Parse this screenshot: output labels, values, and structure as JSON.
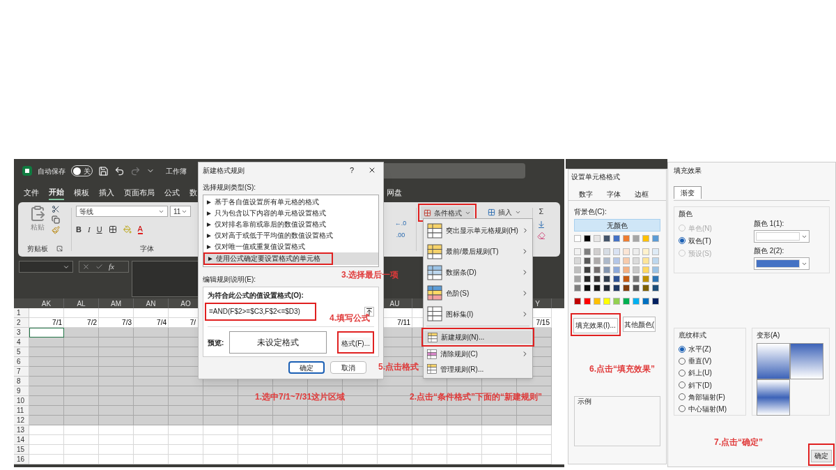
{
  "excel": {
    "autosave_label": "自动保存",
    "autosave_toggle": {
      "label": "关",
      "on": false
    },
    "doc_title": "工作簿",
    "tabs": [
      {
        "label": "文件",
        "selected": false
      },
      {
        "label": "开始",
        "selected": true
      },
      {
        "label": "模板",
        "selected": false
      },
      {
        "label": "插入",
        "selected": false
      },
      {
        "label": "页面布局",
        "selected": false
      },
      {
        "label": "公式",
        "selected": false
      },
      {
        "label": "数",
        "selected": false
      }
    ],
    "tab_cut": "网盘",
    "ribbon": {
      "paste": "粘贴",
      "clipboard_group": "剪贴板",
      "font_name": "等线",
      "font_size": "11",
      "bold": "B",
      "italic": "I",
      "underline": "U",
      "font_color": "A",
      "font_group": "字体",
      "add_decimal": "←.0",
      "remove_decimal": ".00",
      "conditional_format": "条件格式",
      "insert": "插入",
      "sum": "Σ"
    },
    "formula_fx": "fx",
    "columns": [
      {
        "header": "AK",
        "date": "7/1"
      },
      {
        "header": "AL",
        "date": "7/2"
      },
      {
        "header": "AM",
        "date": "7/3"
      },
      {
        "header": "AN",
        "date": "7/4"
      },
      {
        "header": "AO",
        "date": "7/"
      },
      {
        "header": "AU",
        "date": "7/11"
      },
      {
        "header": "Y",
        "date": "7/15"
      }
    ],
    "rows": [
      {
        "number": "1",
        "selected": false,
        "active_first_cell": false
      },
      {
        "number": "2",
        "selected": false,
        "active_first_cell": false
      },
      {
        "number": "3",
        "selected": true,
        "active_first_cell": true
      },
      {
        "number": "4",
        "selected": true,
        "active_first_cell": false
      },
      {
        "number": "5",
        "selected": true,
        "active_first_cell": false
      },
      {
        "number": "6",
        "selected": true,
        "active_first_cell": false
      },
      {
        "number": "7",
        "selected": true,
        "active_first_cell": false
      },
      {
        "number": "8",
        "selected": true,
        "active_first_cell": false
      },
      {
        "number": "9",
        "selected": true,
        "active_first_cell": false
      },
      {
        "number": "10",
        "selected": true,
        "active_first_cell": false
      },
      {
        "number": "11",
        "selected": true,
        "active_first_cell": false
      },
      {
        "number": "12",
        "selected": true,
        "active_first_cell": false
      },
      {
        "number": "13",
        "selected": false,
        "active_first_cell": false
      },
      {
        "number": "14",
        "selected": false,
        "active_first_cell": false
      },
      {
        "number": "15",
        "selected": false,
        "active_first_cell": false
      },
      {
        "number": "16",
        "selected": false,
        "active_first_cell": false
      }
    ]
  },
  "rule_dialog": {
    "title": "新建格式规则",
    "help": "?",
    "type_label": "选择规则类型(S):",
    "rule_types": [
      {
        "label": "► 基于各自值设置所有单元格的格式",
        "selected": false
      },
      {
        "label": "► 只为包含以下内容的单元格设置格式",
        "selected": false
      },
      {
        "label": "► 仅对排名靠前或靠后的数值设置格式",
        "selected": false
      },
      {
        "label": "► 仅对高于或低于平均值的数值设置格式",
        "selected": false
      },
      {
        "label": "► 仅对唯一值或重复值设置格式",
        "selected": false
      },
      {
        "label": "► 使用公式确定要设置格式的单元格",
        "selected": true
      }
    ],
    "edit_label": "编辑规则说明(E):",
    "formula_label": "为符合此公式的值设置格式(O):",
    "formula": "=AND(F$2>=$C3,F$2<=$D3)",
    "preview_label": "预览:",
    "preview_text": "未设定格式",
    "format_button": "格式(F)...",
    "ok": "确定",
    "cancel": "取消"
  },
  "cf_menu": {
    "items": [
      {
        "label": "突出显示单元格规则(H)",
        "kind": "highlight",
        "submenu": true
      },
      {
        "label": "最前/最后规则(T)",
        "kind": "topbottom",
        "submenu": true
      },
      {
        "label": "数据条(D)",
        "kind": "databar",
        "submenu": true
      },
      {
        "label": "色阶(S)",
        "kind": "colorscale",
        "submenu": true
      },
      {
        "label": "图标集(I)",
        "kind": "iconset",
        "submenu": true
      },
      {
        "label": "新建规则(N)...",
        "kind": "newrule",
        "submenu": false
      },
      {
        "label": "清除规则(C)",
        "kind": "clear",
        "submenu": true
      },
      {
        "label": "管理规则(R)...",
        "kind": "manage",
        "submenu": false
      }
    ]
  },
  "format_dialog": {
    "title": "设置单元格格式",
    "tabs": [
      {
        "label": "数字",
        "selected": false
      },
      {
        "label": "字体",
        "selected": false
      },
      {
        "label": "边框",
        "selected": false
      }
    ],
    "bg_label": "背景色(C):",
    "no_color": "无颜色",
    "swatch_rows": [
      {
        "swatches": [
          {
            "color": "#ffffff"
          },
          {
            "color": "#000000"
          },
          {
            "color": "#e7e6e6"
          },
          {
            "color": "#44546a"
          },
          {
            "color": "#4472c4"
          },
          {
            "color": "#ed7d31"
          },
          {
            "color": "#a5a5a5"
          },
          {
            "color": "#ffc000"
          },
          {
            "color": "#5b9bd5"
          }
        ]
      },
      {
        "swatches": [
          {
            "color": "#f2f2f2"
          },
          {
            "color": "#7f7f7f"
          },
          {
            "color": "#d0cece"
          },
          {
            "color": "#d6dce4"
          },
          {
            "color": "#d9e2f3"
          },
          {
            "color": "#fbe5d5"
          },
          {
            "color": "#ededed"
          },
          {
            "color": "#fff2cc"
          },
          {
            "color": "#deebf6"
          }
        ]
      },
      {
        "swatches": [
          {
            "color": "#d8d8d8"
          },
          {
            "color": "#595959"
          },
          {
            "color": "#aeabab"
          },
          {
            "color": "#adb9ca"
          },
          {
            "color": "#b4c6e7"
          },
          {
            "color": "#f7cbac"
          },
          {
            "color": "#dbdbdb"
          },
          {
            "color": "#fee599"
          },
          {
            "color": "#bdd7ee"
          }
        ]
      },
      {
        "swatches": [
          {
            "color": "#bfbfbf"
          },
          {
            "color": "#3f3f3f"
          },
          {
            "color": "#757070"
          },
          {
            "color": "#8496b0"
          },
          {
            "color": "#8eaadb"
          },
          {
            "color": "#f4b183"
          },
          {
            "color": "#c9c9c9"
          },
          {
            "color": "#ffd965"
          },
          {
            "color": "#9cc3e5"
          }
        ]
      },
      {
        "swatches": [
          {
            "color": "#a5a5a5"
          },
          {
            "color": "#262626"
          },
          {
            "color": "#3a3838"
          },
          {
            "color": "#323f4f"
          },
          {
            "color": "#2f5496"
          },
          {
            "color": "#c55a11"
          },
          {
            "color": "#7b7b7b"
          },
          {
            "color": "#bf9000"
          },
          {
            "color": "#2e75b5"
          }
        ]
      },
      {
        "swatches": [
          {
            "color": "#7f7f7f"
          },
          {
            "color": "#0c0c0c"
          },
          {
            "color": "#171616"
          },
          {
            "color": "#222a35"
          },
          {
            "color": "#1f3864"
          },
          {
            "color": "#833c0b"
          },
          {
            "color": "#525252"
          },
          {
            "color": "#7f6000"
          },
          {
            "color": "#1e4e79"
          }
        ]
      },
      {
        "swatches": [
          {
            "color": "#c00000"
          },
          {
            "color": "#ff0000"
          },
          {
            "color": "#ffc000"
          },
          {
            "color": "#ffff00"
          },
          {
            "color": "#92d050"
          },
          {
            "color": "#00b050"
          },
          {
            "color": "#00b0f0"
          },
          {
            "color": "#0070c0"
          },
          {
            "color": "#002060"
          }
        ]
      }
    ],
    "fill_effects_button": "填充效果(I)...",
    "more_colors_button": "其他颜色(",
    "sample_label": "示例"
  },
  "fill_dialog": {
    "title": "填充效果",
    "tab": {
      "label": "渐变",
      "selected": true
    },
    "colors_group": "颜色",
    "color_modes": [
      {
        "label": "单色(N)",
        "selected": false,
        "disabled": true
      },
      {
        "label": "双色(T)",
        "selected": true,
        "disabled": false
      },
      {
        "label": "预设(S)",
        "selected": false,
        "disabled": true
      }
    ],
    "color_pickers": [
      {
        "label": "颜色 1(1):",
        "color": "#ffffff"
      },
      {
        "label": "颜色 2(2):",
        "color": "#4472c4"
      }
    ],
    "shading_group": "底纹样式",
    "shading_styles": [
      {
        "label": "水平(Z)",
        "selected": true
      },
      {
        "label": "垂直(V)",
        "selected": false
      },
      {
        "label": "斜上(U)",
        "selected": false
      },
      {
        "label": "斜下(D)",
        "selected": false
      },
      {
        "label": "角部辐射(F)",
        "selected": false
      },
      {
        "label": "中心辐射(M)",
        "selected": false
      }
    ],
    "variants_group": "变形(A)",
    "ok": "确定"
  },
  "annotations": [
    "3.选择最后一项",
    "4.填写公式",
    "5.点击格式",
    "1.选中7/1~7/31这片区域",
    "2.点击“条件格式”下面的“新建规则”",
    "6.点击“填充效果”",
    "7.点击“确定”"
  ]
}
